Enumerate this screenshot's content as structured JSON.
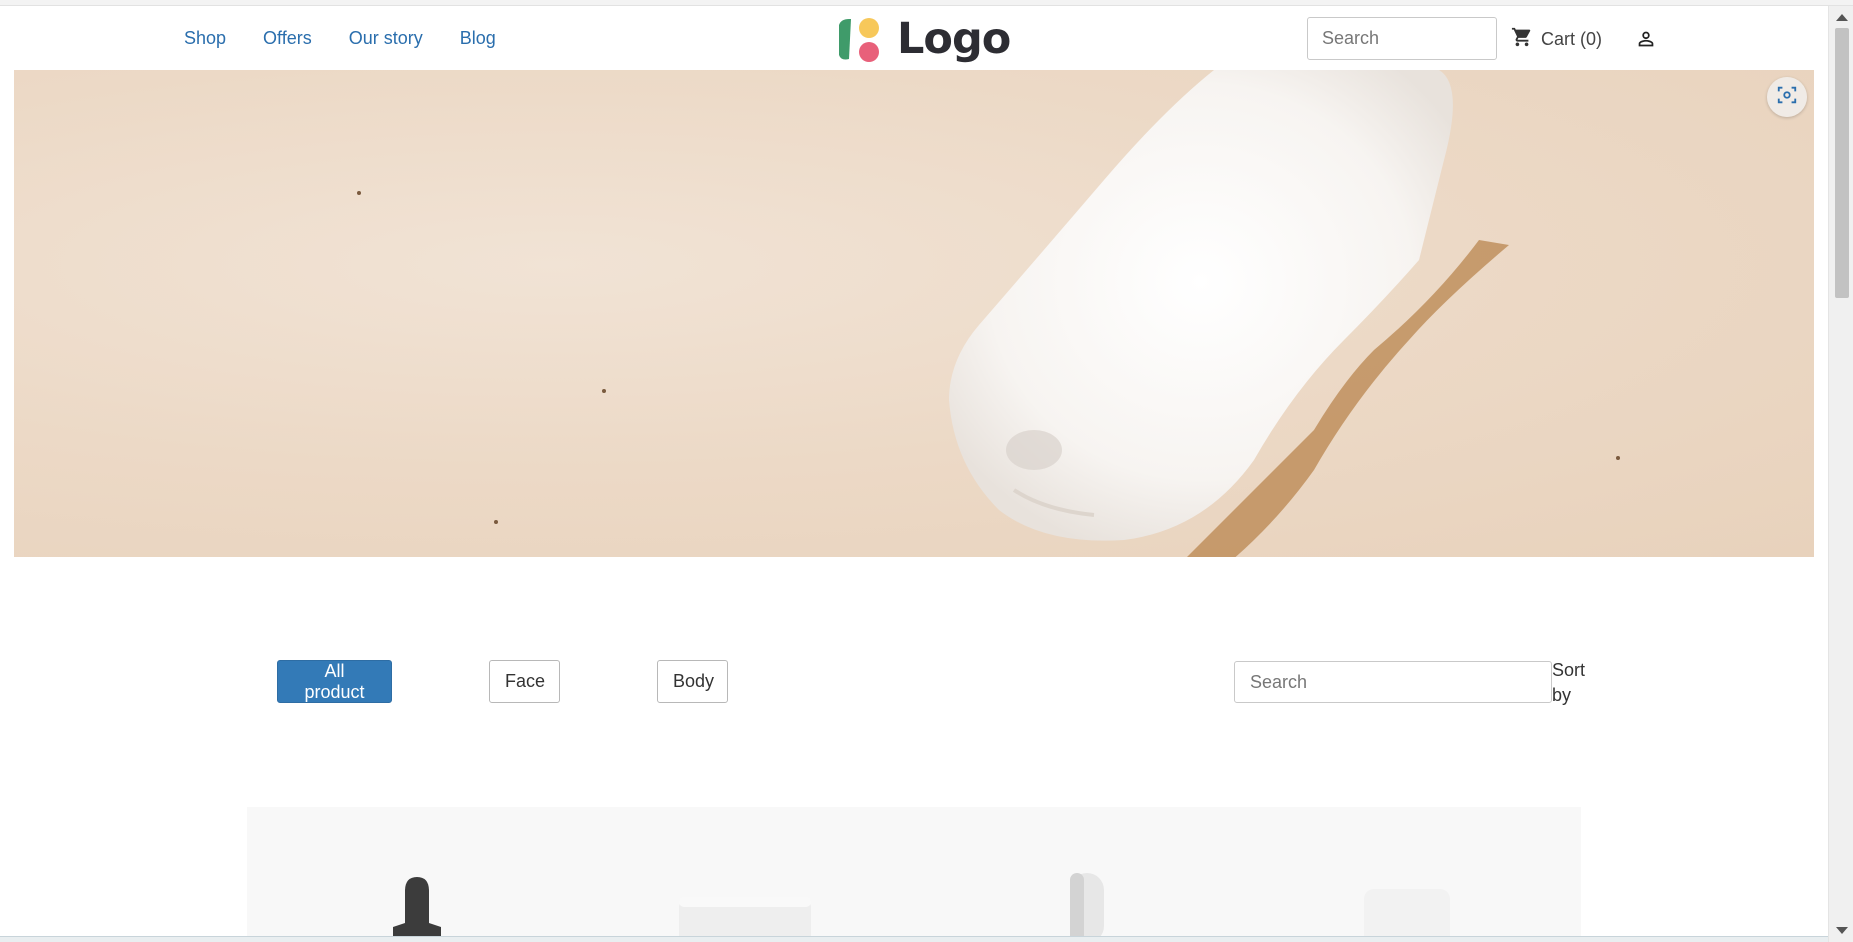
{
  "header": {
    "nav": [
      "Shop",
      "Offers",
      "Our story",
      "Blog"
    ],
    "logo_text": "Logo",
    "search_placeholder": "Search",
    "cart_label": "Cart (0)"
  },
  "filters": {
    "buttons": [
      "All product",
      "Face",
      "Body"
    ],
    "active": "All product",
    "search_placeholder": "Search",
    "sort_label": "Sort by"
  },
  "colors": {
    "link": "#2a6ead",
    "primary_button": "#337ab7",
    "logo_green": "#3f9b6a",
    "logo_yellow": "#f7c85a",
    "logo_pink": "#e8607a"
  },
  "icons": [
    "cart-icon",
    "user-icon",
    "scan-icon"
  ]
}
